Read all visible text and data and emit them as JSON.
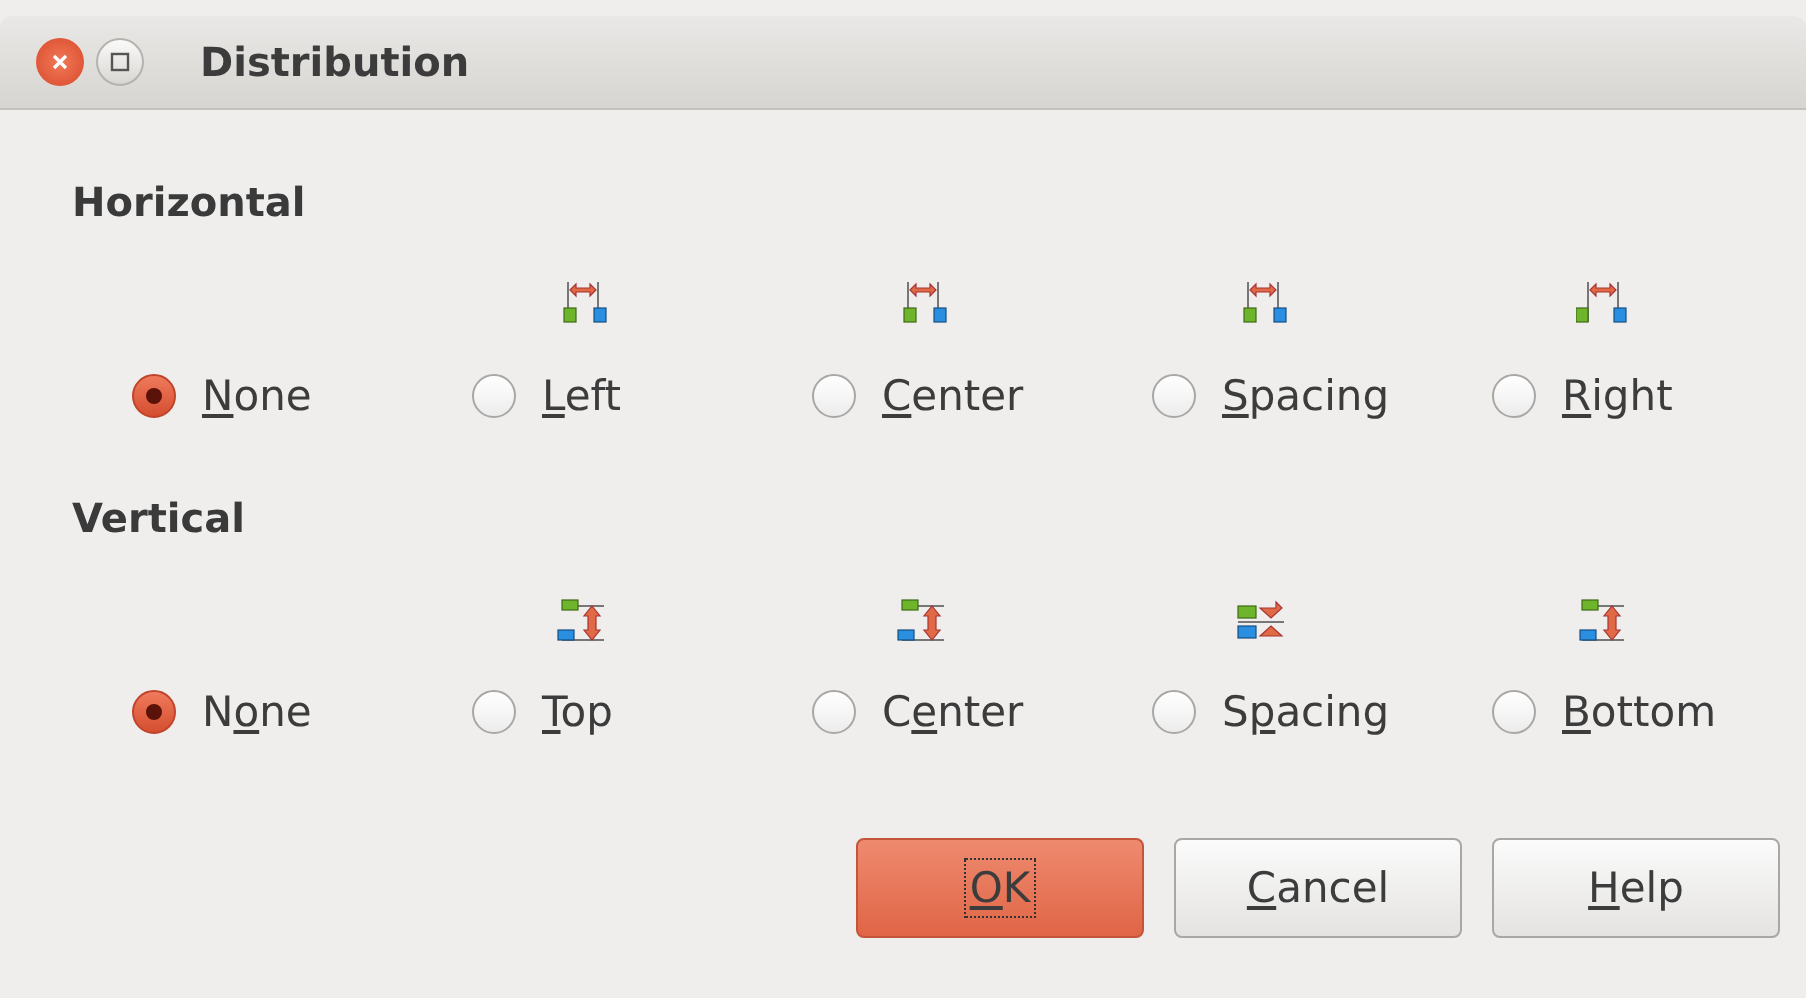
{
  "window": {
    "title": "Distribution"
  },
  "groups": [
    {
      "kind": "horizontal",
      "title": "Horizontal",
      "options": [
        {
          "key": "N",
          "post": "one",
          "selected": true
        },
        {
          "key": "L",
          "post": "eft",
          "selected": false
        },
        {
          "key": "C",
          "post": "enter",
          "selected": false
        },
        {
          "key": "S",
          "post": "pacing",
          "selected": false
        },
        {
          "key": "R",
          "post": "ight",
          "selected": false
        }
      ]
    },
    {
      "kind": "vertical",
      "title": "Vertical",
      "options": [
        {
          "pre": "N",
          "key": "o",
          "post": "ne",
          "selected": true
        },
        {
          "key": "T",
          "post": "op",
          "selected": false
        },
        {
          "pre": "C",
          "key": "e",
          "post": "nter",
          "selected": false
        },
        {
          "pre": "S",
          "key": "p",
          "post": "acing",
          "selected": false
        },
        {
          "key": "B",
          "post": "ottom",
          "selected": false
        }
      ]
    }
  ],
  "buttons": [
    {
      "key": "O",
      "post": "K",
      "kind": "default"
    },
    {
      "key": "C",
      "post": "ancel",
      "kind": "normal"
    },
    {
      "key": "H",
      "post": "elp",
      "kind": "normal"
    }
  ]
}
